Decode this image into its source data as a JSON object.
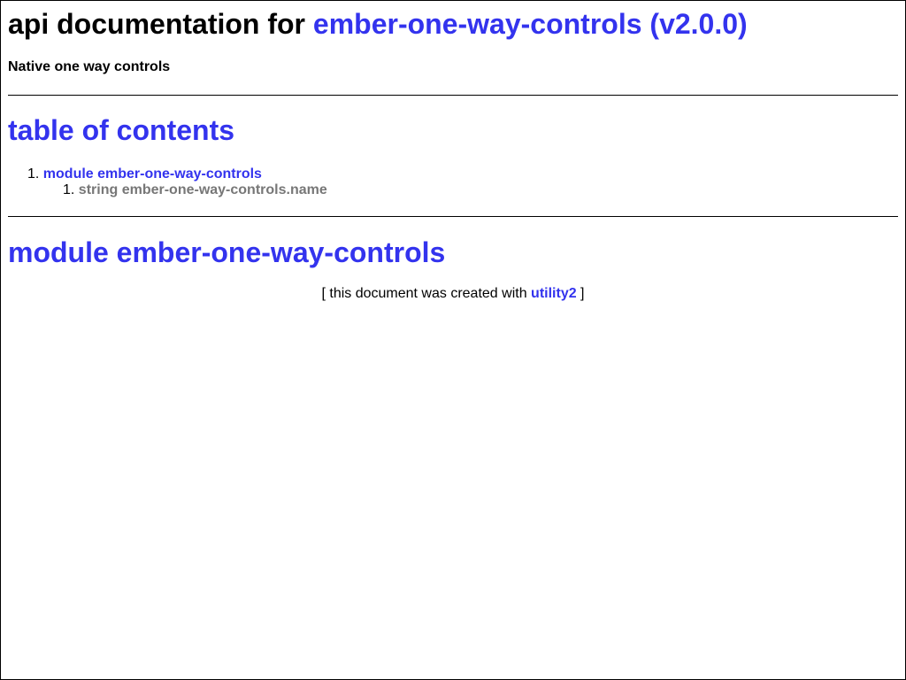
{
  "header": {
    "title_prefix": "api documentation for ",
    "package_link": "ember-one-way-controls (v2.0.0)",
    "description": "Native one way controls"
  },
  "toc": {
    "heading": "table of contents",
    "items": [
      {
        "number": "1.",
        "label": "module ember-one-way-controls",
        "children": [
          {
            "number": "1.",
            "label": "string ember-one-way-controls.name"
          }
        ]
      }
    ]
  },
  "module_section": {
    "heading": "module ember-one-way-controls"
  },
  "footer": {
    "open": "[ this document was created with ",
    "link": "utility2",
    "close": " ]"
  },
  "colors": {
    "link": "#3333ee",
    "muted_link": "#777777",
    "text": "#000000",
    "background": "#ffffff"
  }
}
